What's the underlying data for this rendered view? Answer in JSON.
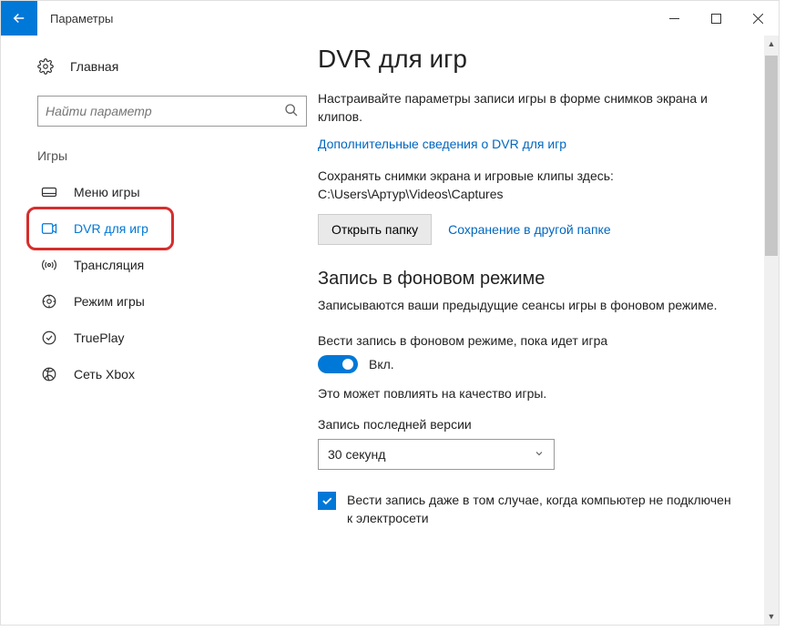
{
  "window": {
    "title": "Параметры"
  },
  "sidebar": {
    "home": "Главная",
    "search_placeholder": "Найти параметр",
    "category": "Игры",
    "items": [
      {
        "label": "Меню игры"
      },
      {
        "label": "DVR для игр"
      },
      {
        "label": "Трансляция"
      },
      {
        "label": "Режим игры"
      },
      {
        "label": "TruePlay"
      },
      {
        "label": "Сеть Xbox"
      }
    ]
  },
  "main": {
    "title": "DVR для игр",
    "intro": "Настраивайте параметры записи игры в форме снимков экрана и клипов.",
    "more_link": "Дополнительные сведения о DVR для игр",
    "save_path_text": "Сохранять снимки экрана и игровые клипы здесь: C:\\Users\\Артур\\Videos\\Captures",
    "open_folder_btn": "Открыть папку",
    "save_other_link": "Сохранение в другой папке",
    "bg_title": "Запись в фоновом режиме",
    "bg_desc": "Записываются ваши предыдущие сеансы игры в фоновом режиме.",
    "bg_toggle_label": "Вести запись в фоновом режиме, пока идет игра",
    "toggle_state": "Вкл.",
    "quality_note": "Это может повлиять на качество игры.",
    "last_record_label": "Запись последней версии",
    "last_record_value": "30 секунд",
    "checkbox_label": "Вести запись даже в том случае, когда компьютер не подключен к электросети"
  }
}
